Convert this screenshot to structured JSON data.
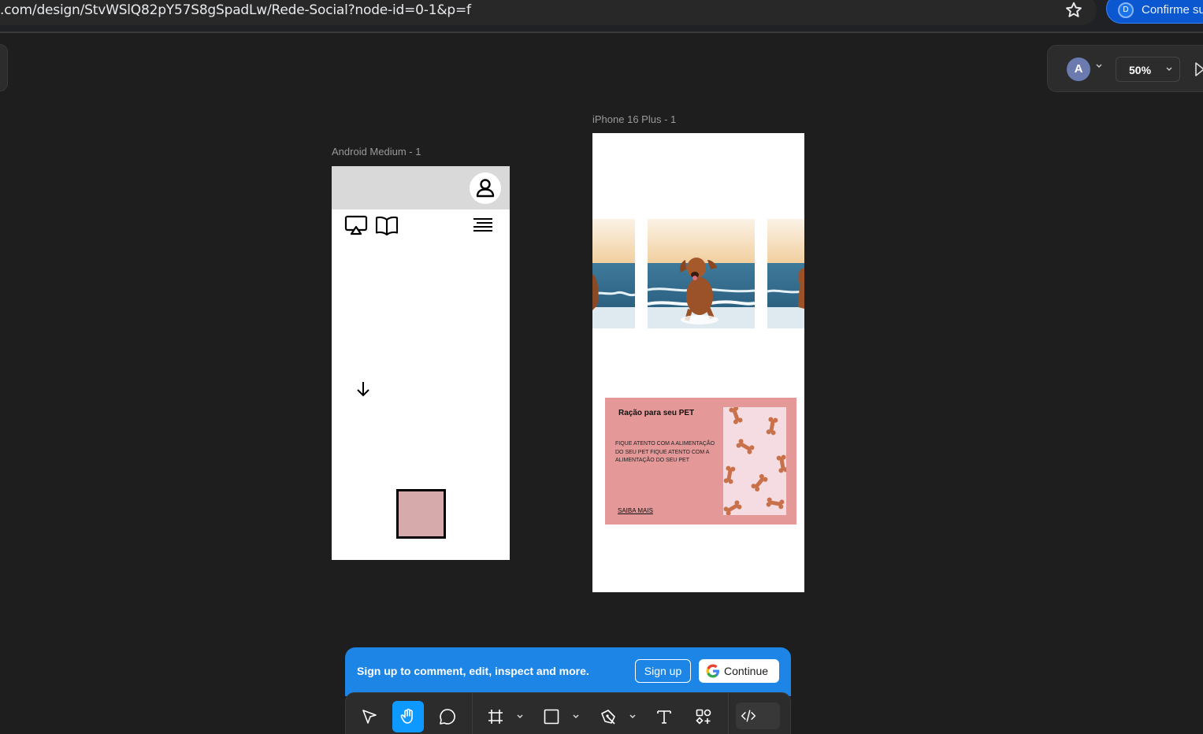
{
  "browser": {
    "url": ".com/design/StvWSlQ82pY57S8gSpadLw/Rede-Social?node-id=0-1&p=f",
    "profile_initial": "D",
    "profile_label": "Confirme su",
    "star_icon": "star-icon"
  },
  "figma": {
    "avatar_initial": "A",
    "zoom": "50%"
  },
  "frames": {
    "android_label": "Android Medium - 1",
    "iphone_label": "iPhone 16 Plus - 1"
  },
  "card": {
    "title": "Ração para seu PET",
    "body": "FIQUE ATENTO COM A ALIMENTAÇÃO DO SEU PET FIQUE ATENTO COM A ALIMENTAÇÃO DO SEU PET",
    "link": "SAIBA MAIS",
    "color": "#e49898"
  },
  "signup_bar": {
    "text": "Sign up to comment, edit, inspect and more.",
    "signup_label": "Sign up",
    "continue_label": "Continue",
    "color": "#1d85e6"
  },
  "toolbar": {
    "tools": [
      "move-tool",
      "hand-tool",
      "comment-tool",
      "frame-tool",
      "shape-tool",
      "pen-tool",
      "text-tool",
      "components-tool",
      "dev-mode-toggle"
    ],
    "active_tool": "hand-tool",
    "accent": "#0d99ff"
  }
}
